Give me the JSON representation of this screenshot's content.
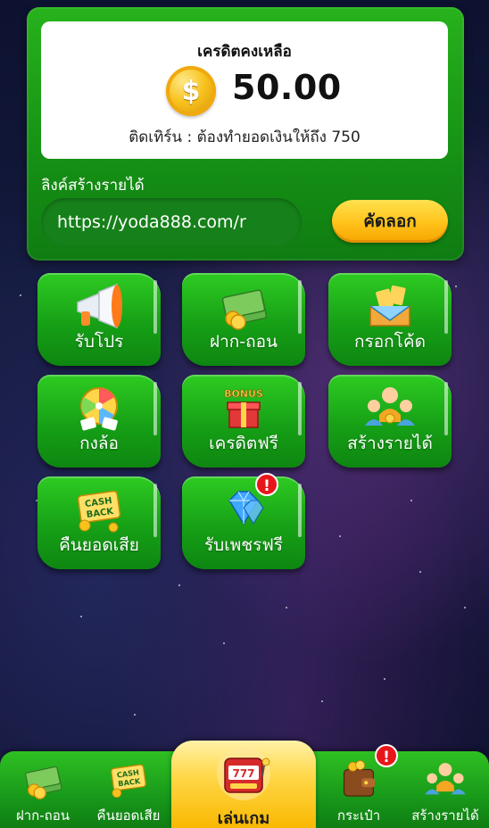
{
  "credit": {
    "title": "เครดิตคงเหลือ",
    "amount": "50.00",
    "turnover_text": "ติดเทิร์น : ต้องทำยอดเงินให้ถึง 750",
    "coin_symbol": "$"
  },
  "referral": {
    "label": "ลิงค์สร้างรายได้",
    "link_value": "https://yoda888.com/r",
    "copy_button": "คัดลอก"
  },
  "menu": [
    {
      "label": "รับโปร",
      "icon": "megaphone-icon"
    },
    {
      "label": "ฝาก-ถอน",
      "icon": "money-stack-icon"
    },
    {
      "label": "กรอกโค้ด",
      "icon": "coupon-code-icon"
    },
    {
      "label": "กงล้อ",
      "icon": "prize-wheel-icon"
    },
    {
      "label": "เครดิตฟรี",
      "icon": "bonus-gift-icon"
    },
    {
      "label": "สร้างรายได้",
      "icon": "affiliate-people-icon"
    },
    {
      "label": "คืนยอดเสีย",
      "icon": "cashback-icon"
    },
    {
      "label": "รับเพชรฟรี",
      "icon": "diamond-icon",
      "badge": "!"
    }
  ],
  "bottom_nav": [
    {
      "label": "ฝาก-ถอน",
      "icon": "money-stack-icon"
    },
    {
      "label": "คืนยอดเสีย",
      "icon": "cashback-icon"
    },
    {
      "label": "เล่นเกม",
      "icon": "slot-machine-icon"
    },
    {
      "label": "กระเป๋า",
      "icon": "wallet-icon",
      "badge": "!"
    },
    {
      "label": "สร้างรายได้",
      "icon": "affiliate-people-icon"
    }
  ],
  "colors": {
    "primary_green": "#18a018",
    "accent_yellow": "#ffc21a",
    "badge_red": "#e8161b"
  }
}
